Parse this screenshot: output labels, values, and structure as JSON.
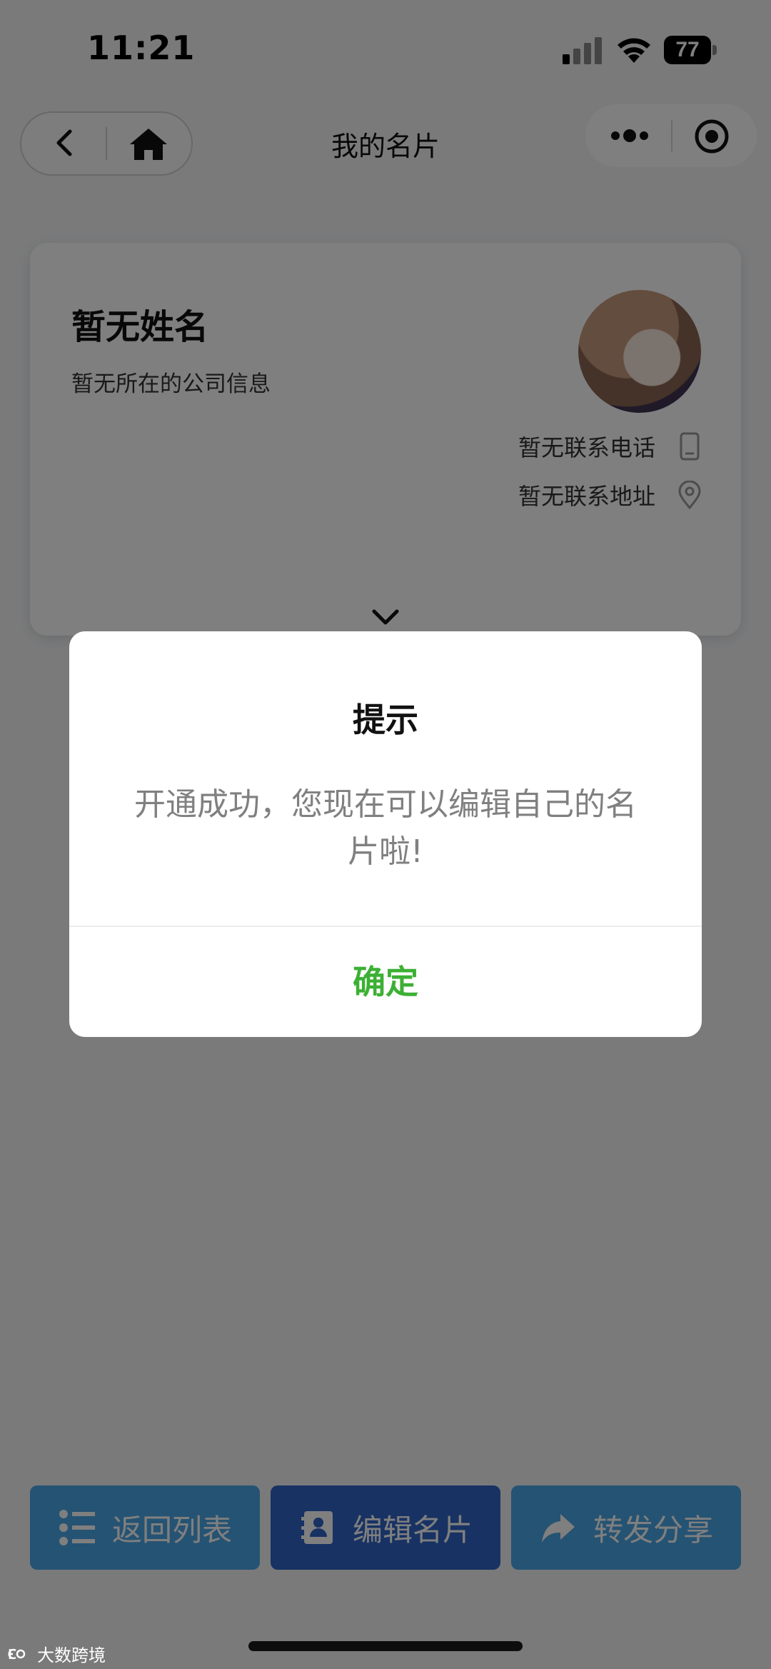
{
  "status_bar": {
    "time": "11:21",
    "battery": "77"
  },
  "nav": {
    "title": "我的名片"
  },
  "card": {
    "name": "暂无姓名",
    "company": "暂无所在的公司信息",
    "phone": "暂无联系电话",
    "address": "暂无联系地址"
  },
  "bottom": {
    "back_label": "返回列表",
    "edit_label": "编辑名片",
    "share_label": "转发分享"
  },
  "dialog": {
    "title": "提示",
    "message": "开通成功，您现在可以编辑自己的名片啦!",
    "confirm_label": "确定"
  },
  "watermark": "大数跨境",
  "colors": {
    "confirm": "#3cb034",
    "edit_button": "#2f64c6",
    "secondary_button": "#4aa6e6"
  }
}
